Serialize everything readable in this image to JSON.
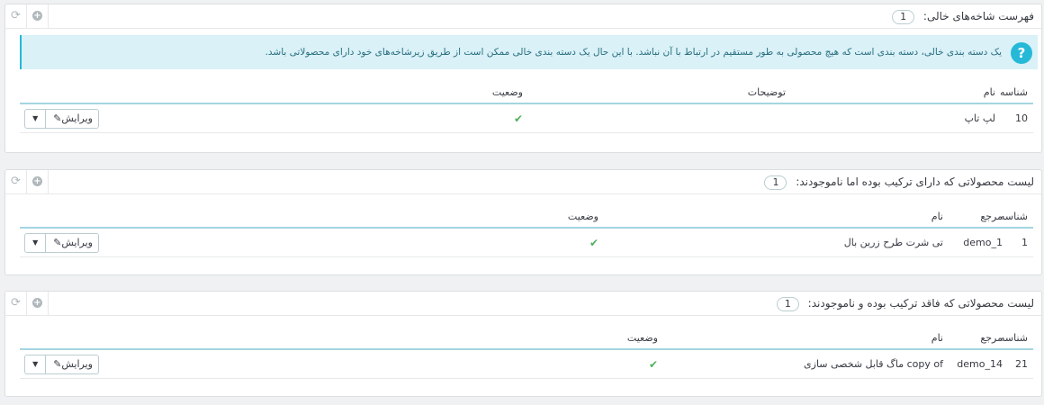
{
  "panels": [
    {
      "title": "فهرست شاخه‌های خالی:",
      "count": "1",
      "alert": "یک دسته بندی خالی، دسته بندی است که هیچ محصولی به طور مستقیم در ارتباط با آن نباشد. با این حال یک دسته بندی خالی ممکن است از طریق زیرشاخه‌های خود دارای محصولاتی باشد.",
      "headers": {
        "id": "شناسه",
        "name": "نام",
        "description": "توضیحات",
        "status": "وضعیت"
      },
      "rows": [
        {
          "id": "10",
          "name": "لپ تاپ",
          "description": "",
          "status": "✔",
          "action": "ویرایش"
        }
      ]
    },
    {
      "title": "لیست محصولاتی که دارای ترکیب بوده اما ناموجودند:",
      "count": "1",
      "headers": {
        "id": "شناسه",
        "reference": "مرجع",
        "name": "نام",
        "status": "وضعیت"
      },
      "rows": [
        {
          "id": "1",
          "reference": "demo_1",
          "name": "تی شرت طرح زرین بال",
          "status": "✔",
          "action": "ویرایش"
        }
      ]
    },
    {
      "title": "لیست محصولاتی که فاقد ترکیب بوده و ناموجودند:",
      "count": "1",
      "headers": {
        "id": "شناسه",
        "reference": "مرجع",
        "name": "نام",
        "status": "وضعیت"
      },
      "rows": [
        {
          "id": "21",
          "reference": "demo_14",
          "name": "copy of ماگ قابل شخصی سازی",
          "status": "✔",
          "action": "ویرایش"
        }
      ]
    }
  ],
  "icons": {
    "refresh": "refresh-icon",
    "add": "add-icon",
    "help": "question-icon",
    "edit": "pencil-icon",
    "caret": "caret-down-icon",
    "status": "check-icon"
  },
  "colors": {
    "accent": "#25b9d7",
    "alert_bg": "#d9f1f7",
    "check": "#4fb15b",
    "header_border": "#a4d5e1"
  }
}
